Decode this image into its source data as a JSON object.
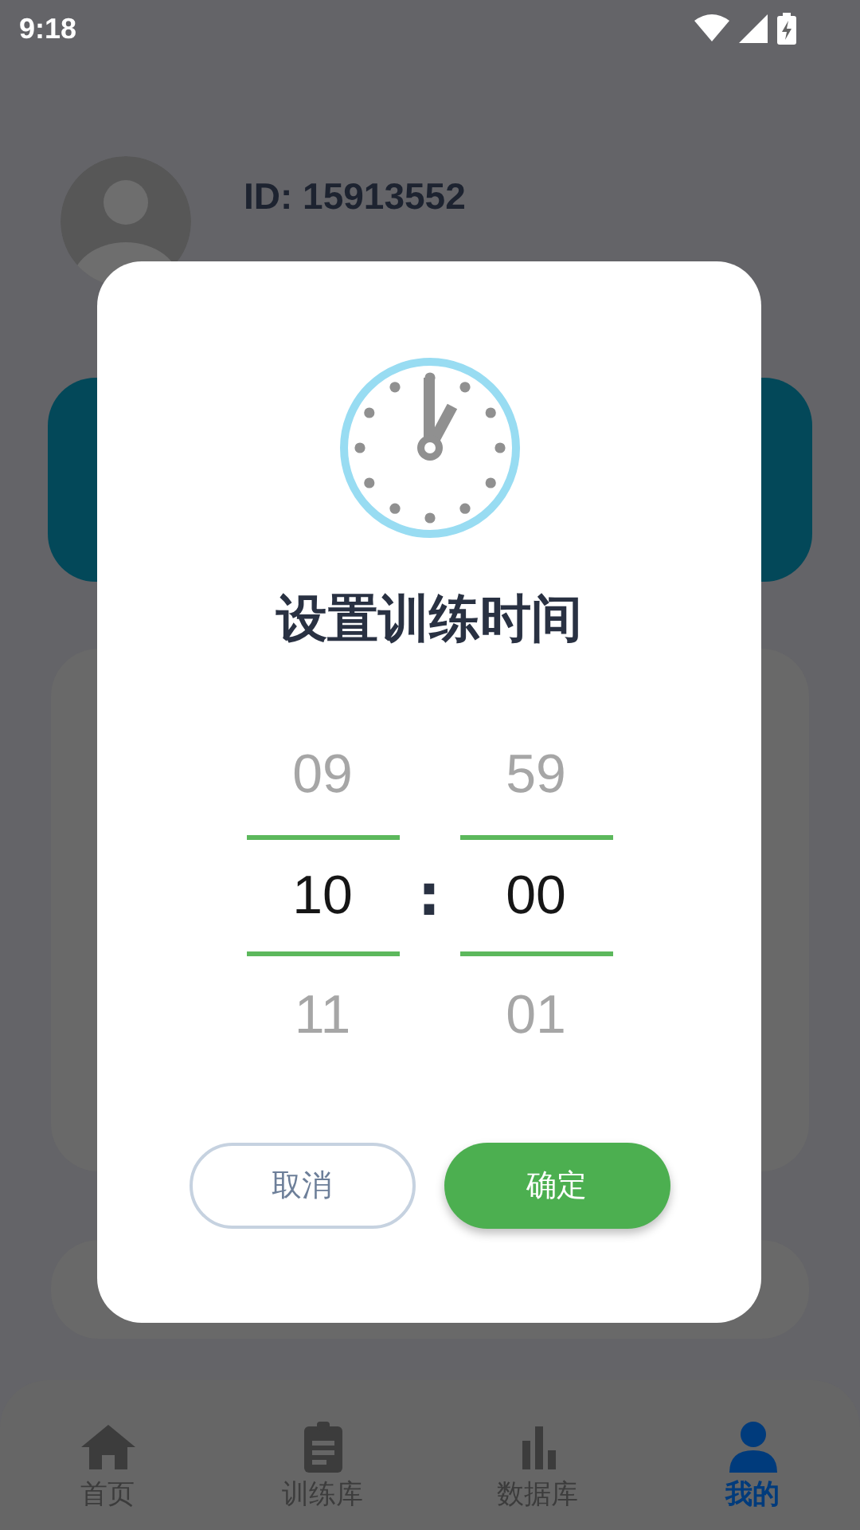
{
  "status_bar": {
    "time": "9:18"
  },
  "profile": {
    "id_label": "ID: 15913552"
  },
  "dialog": {
    "title": "设置训练时间",
    "hour_column": [
      {
        "value": "09",
        "selected": false
      },
      {
        "value": "10",
        "selected": true
      },
      {
        "value": "11",
        "selected": false
      }
    ],
    "separator": ":",
    "minute_column": [
      {
        "value": "59",
        "selected": false
      },
      {
        "value": "00",
        "selected": true
      },
      {
        "value": "01",
        "selected": false
      }
    ],
    "buttons": [
      {
        "label": "取消",
        "kind": "secondary"
      },
      {
        "label": "确定",
        "kind": "primary"
      }
    ]
  },
  "bottom_nav": [
    {
      "label": "首页",
      "kind": "home",
      "selected": false
    },
    {
      "label": "训练库",
      "kind": "clipboard",
      "selected": false
    },
    {
      "label": "数据库",
      "kind": "bars",
      "selected": false
    },
    {
      "label": "我的",
      "kind": "person",
      "selected": true
    }
  ]
}
